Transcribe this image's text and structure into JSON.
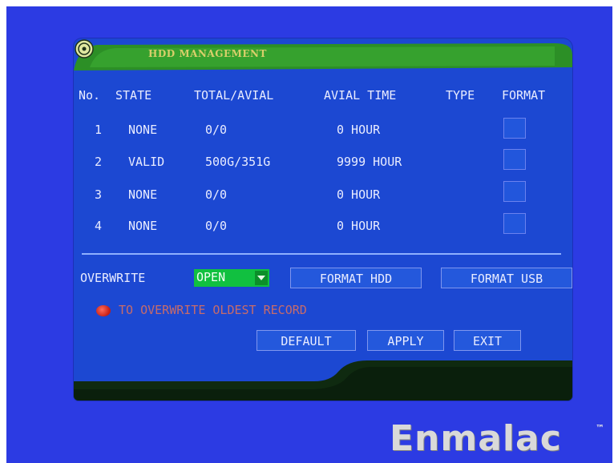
{
  "panel": {
    "title": "HDD MANAGEMENT",
    "icon": "hdd-icon"
  },
  "table": {
    "headers": [
      "No.",
      "STATE",
      "TOTAL/AVIAL",
      "AVIAL TIME",
      "TYPE",
      "FORMAT"
    ],
    "rows": [
      {
        "no": "1",
        "state": "NONE",
        "total": "0/0",
        "time": "0 HOUR",
        "type": ""
      },
      {
        "no": "2",
        "state": "VALID",
        "total": "500G/351G",
        "time": "9999 HOUR",
        "type": ""
      },
      {
        "no": "3",
        "state": "NONE",
        "total": "0/0",
        "time": "0 HOUR",
        "type": ""
      },
      {
        "no": "4",
        "state": "NONE",
        "total": "0/0",
        "time": "0 HOUR",
        "type": ""
      }
    ]
  },
  "overwrite": {
    "label": "OVERWRITE",
    "value": "OPEN"
  },
  "buttons": {
    "format_hdd": "FORMAT HDD",
    "format_usb": "FORMAT USB",
    "default": "DEFAULT",
    "apply": "APPLY",
    "exit": "EXIT"
  },
  "hint": "TO OVERWRITE OLDEST RECORD",
  "brand": {
    "name": "Enmalac",
    "tm": "™"
  },
  "colors": {
    "screen_bg": "#2c3be3",
    "panel_bg": "#1c48d2",
    "header_green": "#2f9a2a",
    "select_green": "#11c040",
    "footer_dark": "#0f2a10"
  }
}
